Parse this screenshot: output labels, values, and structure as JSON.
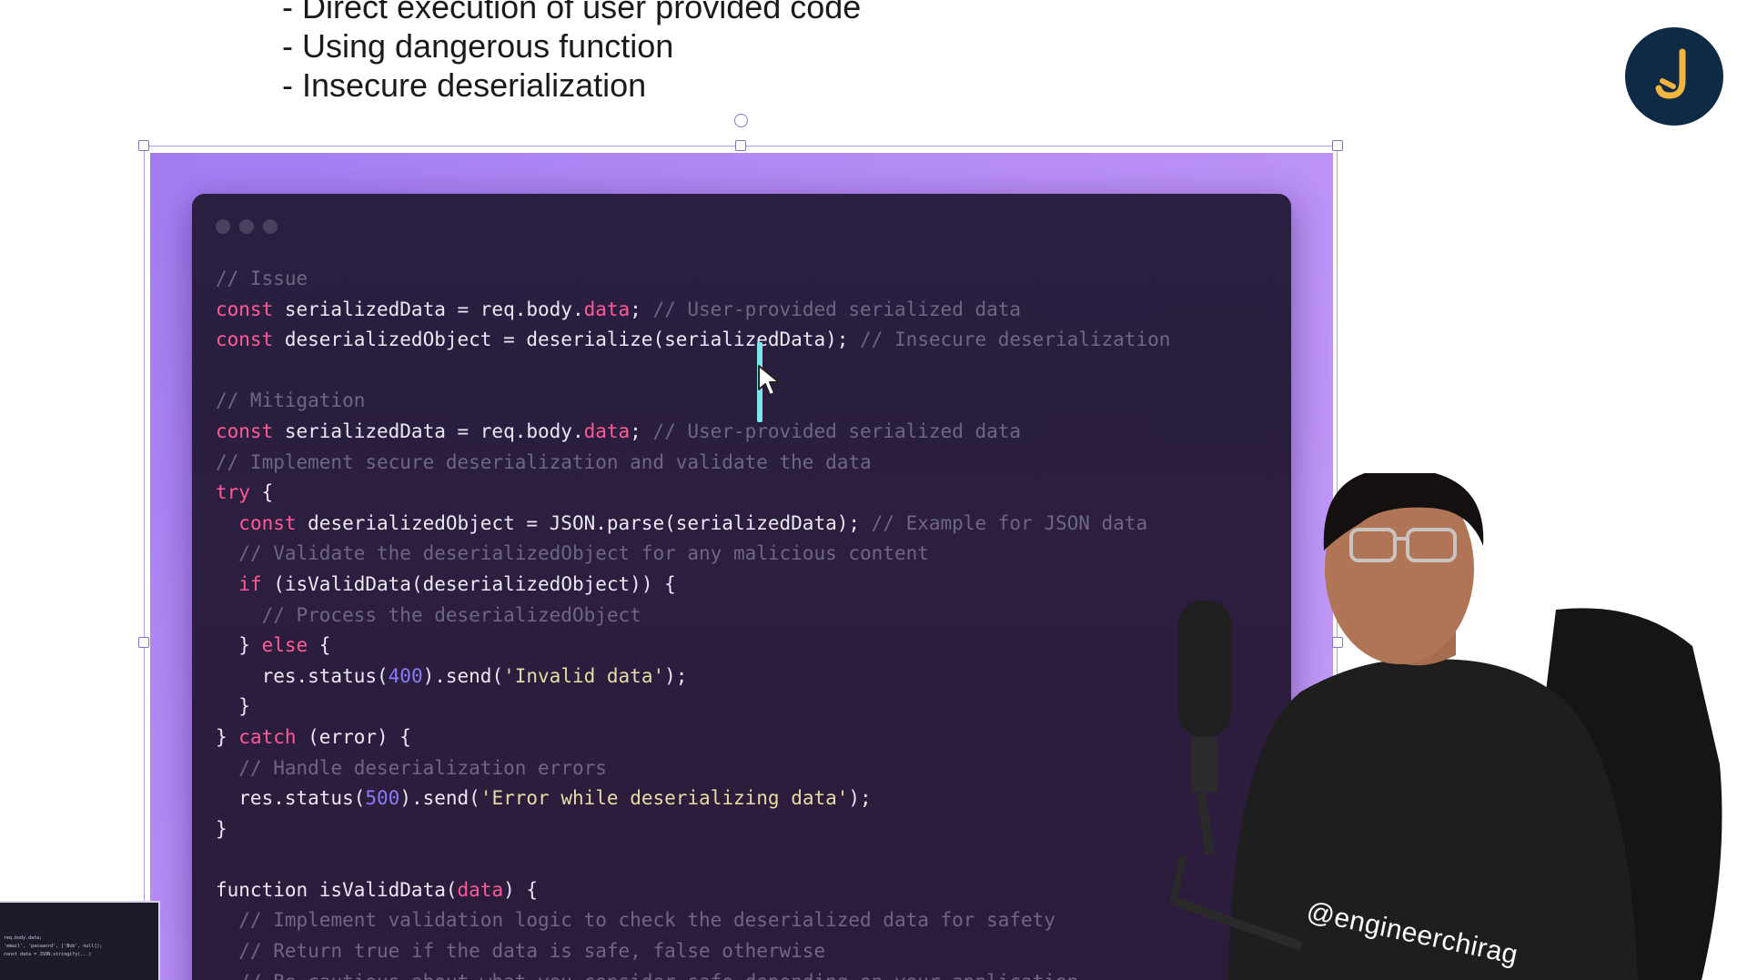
{
  "slide": {
    "bullets": [
      "- Direct execution of user provided code",
      "- Using dangerous function",
      "- Insecure deserialization"
    ]
  },
  "logo": {
    "icon": "hook-logo-icon",
    "background": "#0f2a44",
    "accent": "#f2b640"
  },
  "code_colors": {
    "keyword": "#ff5a96",
    "comment": "#6f6584",
    "number": "#8a7cf6",
    "string": "#e6dca4",
    "plain": "#ece6f5",
    "window": "#2a1f40",
    "backdrop": "#b28af5"
  },
  "code_lines": [
    [
      {
        "t": "cm",
        "v": "// Issue"
      }
    ],
    [
      {
        "t": "kw",
        "v": "const"
      },
      {
        "t": "pl",
        "v": " serializedData = req.body."
      },
      {
        "t": "kw",
        "v": "data"
      },
      {
        "t": "pl",
        "v": "; "
      },
      {
        "t": "cm",
        "v": "// User-provided serialized data"
      }
    ],
    [
      {
        "t": "kw",
        "v": "const"
      },
      {
        "t": "pl",
        "v": " deserializedObject = deserialize(serializedData); "
      },
      {
        "t": "cm",
        "v": "// Insecure deserialization"
      }
    ],
    [],
    [
      {
        "t": "cm",
        "v": "// Mitigation"
      }
    ],
    [
      {
        "t": "kw",
        "v": "const"
      },
      {
        "t": "pl",
        "v": " serializedData = req.body."
      },
      {
        "t": "kw",
        "v": "data"
      },
      {
        "t": "pl",
        "v": "; "
      },
      {
        "t": "cm",
        "v": "// User-provided serialized data"
      }
    ],
    [
      {
        "t": "cm",
        "v": "// Implement secure deserialization and validate the data"
      }
    ],
    [
      {
        "t": "kw",
        "v": "try"
      },
      {
        "t": "pl",
        "v": " {"
      }
    ],
    [
      {
        "t": "pl",
        "v": "  "
      },
      {
        "t": "kw",
        "v": "const"
      },
      {
        "t": "pl",
        "v": " deserializedObject = JSON.parse(serializedData); "
      },
      {
        "t": "cm",
        "v": "// Example for JSON data"
      }
    ],
    [
      {
        "t": "pl",
        "v": "  "
      },
      {
        "t": "cm",
        "v": "// Validate the deserializedObject for any malicious content"
      }
    ],
    [
      {
        "t": "pl",
        "v": "  "
      },
      {
        "t": "kw",
        "v": "if"
      },
      {
        "t": "pl",
        "v": " (isValidData(deserializedObject)) {"
      }
    ],
    [
      {
        "t": "pl",
        "v": "    "
      },
      {
        "t": "cm",
        "v": "// Process the deserializedObject"
      }
    ],
    [
      {
        "t": "pl",
        "v": "  } "
      },
      {
        "t": "kw",
        "v": "else"
      },
      {
        "t": "pl",
        "v": " {"
      }
    ],
    [
      {
        "t": "pl",
        "v": "    res.status("
      },
      {
        "t": "num",
        "v": "400"
      },
      {
        "t": "pl",
        "v": ").send("
      },
      {
        "t": "str",
        "v": "'Invalid data'"
      },
      {
        "t": "pl",
        "v": ");"
      }
    ],
    [
      {
        "t": "pl",
        "v": "  }"
      }
    ],
    [
      {
        "t": "pl",
        "v": "} "
      },
      {
        "t": "kw",
        "v": "catch"
      },
      {
        "t": "pl",
        "v": " (error) {"
      }
    ],
    [
      {
        "t": "pl",
        "v": "  "
      },
      {
        "t": "cm",
        "v": "// Handle deserialization errors"
      }
    ],
    [
      {
        "t": "pl",
        "v": "  res.status("
      },
      {
        "t": "num",
        "v": "500"
      },
      {
        "t": "pl",
        "v": ").send("
      },
      {
        "t": "str",
        "v": "'Error while deserializing data'"
      },
      {
        "t": "pl",
        "v": ");"
      }
    ],
    [
      {
        "t": "pl",
        "v": "}"
      }
    ],
    [],
    [
      {
        "t": "pl",
        "v": "function isValidData("
      },
      {
        "t": "kw",
        "v": "data"
      },
      {
        "t": "pl",
        "v": ") {"
      }
    ],
    [
      {
        "t": "pl",
        "v": "  "
      },
      {
        "t": "cm",
        "v": "// Implement validation logic to check the deserialized data for safety"
      }
    ],
    [
      {
        "t": "pl",
        "v": "  "
      },
      {
        "t": "cm",
        "v": "// Return true if the data is safe, false otherwise"
      }
    ],
    [
      {
        "t": "pl",
        "v": "  "
      },
      {
        "t": "cm",
        "v": "// Be cautious about what you consider safe depending on your application"
      }
    ]
  ],
  "thumbnail": {
    "lines": [
      "req.body.data;",
      "",
      "'email', 'password', ['Bob', null]);",
      "const data = JSON.stringify(...)"
    ]
  },
  "presenter": {
    "watermark": "@engineerchirag"
  }
}
